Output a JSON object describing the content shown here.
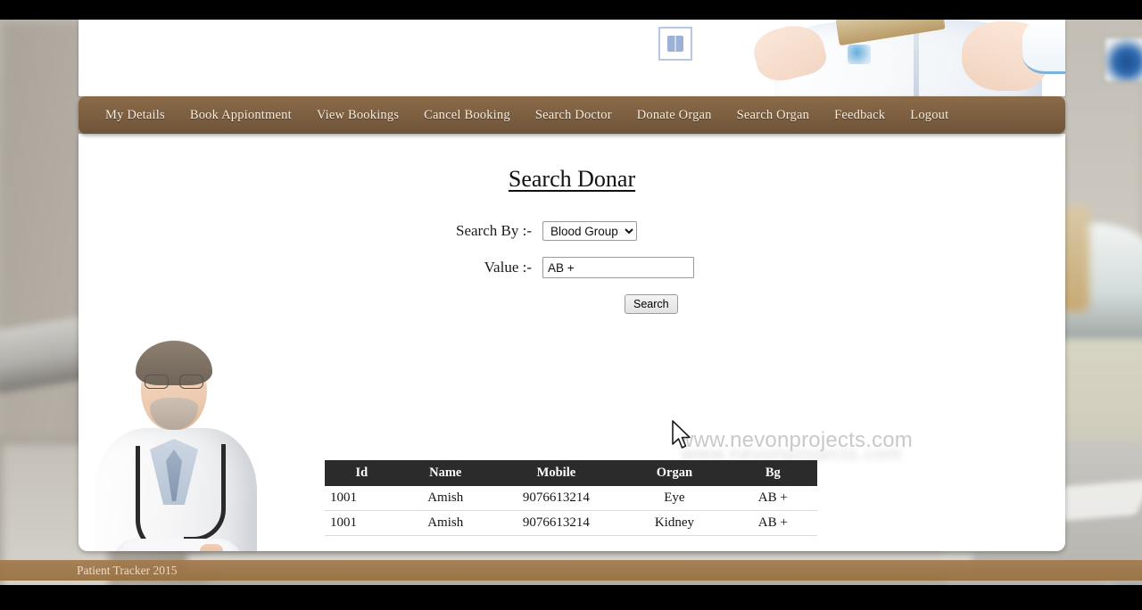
{
  "nav": {
    "items": [
      {
        "label": "My Details"
      },
      {
        "label": "Book Appiontment"
      },
      {
        "label": "View Bookings"
      },
      {
        "label": "Cancel Booking"
      },
      {
        "label": "Search Doctor"
      },
      {
        "label": "Donate Organ"
      },
      {
        "label": "Search Organ"
      },
      {
        "label": "Feedback"
      },
      {
        "label": "Logout"
      }
    ]
  },
  "page": {
    "title": "Search Donar"
  },
  "form": {
    "search_by_label": "Search By :-",
    "search_by_value": "Blood Group",
    "search_by_options": [
      "Blood Group"
    ],
    "value_label": "Value :-",
    "value_value": "AB +",
    "value_placeholder": "",
    "search_button": "Search"
  },
  "watermark": {
    "text": "www.nevonprojects.com"
  },
  "results": {
    "headers": [
      "Id",
      "Name",
      "Mobile",
      "Organ",
      "Bg"
    ],
    "rows": [
      {
        "id": "1001",
        "name": "Amish",
        "mobile": "9076613214",
        "organ": "Eye",
        "bg": "AB +"
      },
      {
        "id": "1001",
        "name": "Amish",
        "mobile": "9076613214",
        "organ": "Kidney",
        "bg": "AB +"
      }
    ]
  },
  "footer": {
    "text": "Patient Tracker 2015"
  },
  "colors": {
    "nav_brown": "#7e6041",
    "footer_brown": "#97713f",
    "table_header": "#2b2b2b",
    "card_white": "#ffffff",
    "watermark_grey": "#c9c9c9"
  }
}
